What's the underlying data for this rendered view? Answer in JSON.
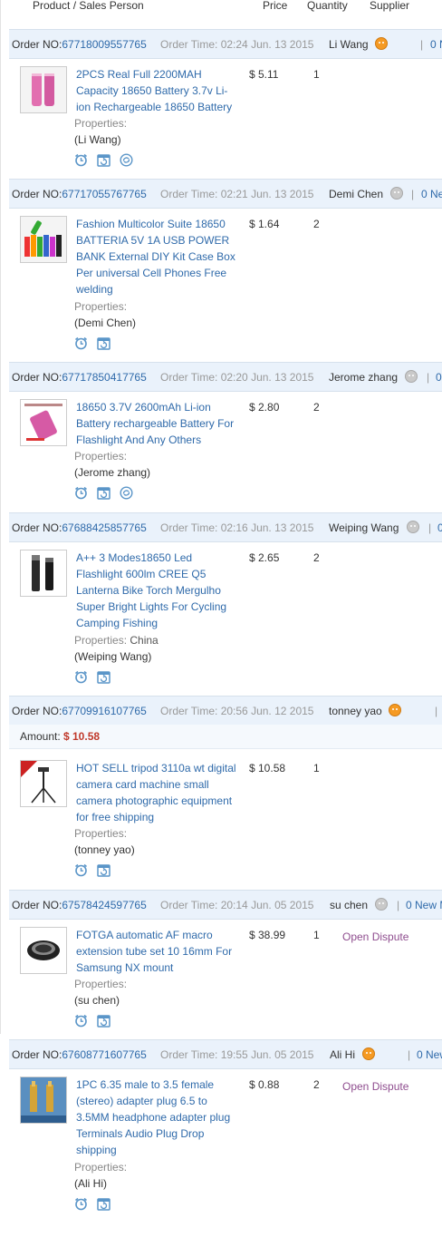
{
  "header": {
    "col_product": "Product / Sales Person",
    "col_price": "Price",
    "col_quantity": "Quantity",
    "col_supplier": "Supplier"
  },
  "labels": {
    "order_no": "Order NO:",
    "order_time": "Order Time:",
    "properties": "Properties:",
    "amount": "Amount:"
  },
  "colors": {
    "link_blue": "#2f6aaa",
    "order_bar_bg": "#eaf2fb",
    "amount_red": "#c0392b",
    "dispute_purple": "#8e4c8e",
    "icon_blue": "#5a95c8"
  },
  "orders": [
    {
      "order_no": "67718009557765",
      "order_time": "02:24 Jun. 13 2015",
      "seller": "Li Wang",
      "seller_status": "online",
      "sep": "|",
      "new_msg": "0 N",
      "product_title": "2PCS Real Full 2200MAH Capacity 18650 Battery 3.7v Li-ion Rechargeable 18650 Battery",
      "properties": "",
      "buyer": "(Li Wang)",
      "price": "$ 5.11",
      "quantity": "1",
      "action_icons": [
        "alarm-clock-icon",
        "calendar-refresh-icon",
        "refresh-circle-icon"
      ]
    },
    {
      "order_no": "67717055767765",
      "order_time": "02:21 Jun. 13 2015",
      "seller": "Demi Chen",
      "seller_status": "offline",
      "sep": "|",
      "new_msg": "0 Ne",
      "product_title": "Fashion Multicolor Suite 18650 BATTERIA 5V 1A USB POWER BANK External DIY Kit Case Box Per universal Cell Phones Free welding",
      "properties": "",
      "buyer": "(Demi Chen)",
      "price": "$ 1.64",
      "quantity": "2",
      "action_icons": [
        "alarm-clock-icon",
        "calendar-refresh-icon"
      ]
    },
    {
      "order_no": "67717850417765",
      "order_time": "02:20 Jun. 13 2015",
      "seller": "Jerome zhang",
      "seller_status": "offline",
      "sep": "|",
      "new_msg": "0",
      "product_title": "18650 3.7V 2600mAh Li-ion Battery rechargeable Battery For Flashlight And Any Others",
      "properties": "",
      "buyer": "(Jerome zhang)",
      "price": "$ 2.80",
      "quantity": "2",
      "action_icons": [
        "alarm-clock-icon",
        "calendar-refresh-icon",
        "refresh-circle-icon"
      ]
    },
    {
      "order_no": "67688425857765",
      "order_time": "02:16 Jun. 13 2015",
      "seller": "Weiping Wang",
      "seller_status": "offline",
      "sep": "|",
      "new_msg": "0",
      "product_title": "A++ 3 Modes18650 Led Flashlight 600lm CREE Q5 Lanterna Bike Torch Mergulho Super Bright Lights For Cycling Camping Fishing",
      "properties": "China",
      "buyer": "(Weiping Wang)",
      "price": "$ 2.65",
      "quantity": "2",
      "action_icons": [
        "alarm-clock-icon",
        "calendar-refresh-icon"
      ]
    },
    {
      "order_no": "67709916107765",
      "order_time": "20:56 Jun. 12 2015",
      "seller": "tonney yao",
      "seller_status": "online",
      "sep": "|",
      "new_msg": "",
      "amount": "$ 10.58",
      "product_title": "HOT SELL tripod 3110a wt digital camera card machine small camera photographic equipment for free shipping",
      "properties": "",
      "buyer": "(tonney yao)",
      "price": "$ 10.58",
      "quantity": "1",
      "action_icons": [
        "alarm-clock-icon",
        "calendar-refresh-icon"
      ]
    },
    {
      "order_no": "67578424597765",
      "order_time": "20:14 Jun. 05 2015",
      "seller": "su chen",
      "seller_status": "offline",
      "sep": "|",
      "new_msg": "0 New M",
      "product_title": "FOTGA automatic AF macro extension tube set 10 16mm For Samsung NX mount",
      "properties": "",
      "buyer": "(su chen)",
      "price": "$ 38.99",
      "quantity": "1",
      "status": "Open Dispute",
      "action_icons": [
        "alarm-clock-icon",
        "calendar-refresh-icon"
      ]
    },
    {
      "order_no": "67608771607765",
      "order_time": "19:55 Jun. 05 2015",
      "seller": "Ali Hi",
      "seller_status": "online",
      "sep": "|",
      "new_msg": "0 New",
      "product_title": "1PC 6.35 male to 3.5 female (stereo) adapter plug 6.5 to 3.5MM headphone adapter plug Terminals Audio Plug Drop shipping",
      "properties": "",
      "buyer": "(Ali Hi)",
      "price": "$ 0.88",
      "quantity": "2",
      "status": "Open Dispute",
      "action_icons": [
        "alarm-clock-icon",
        "calendar-refresh-icon"
      ]
    }
  ]
}
